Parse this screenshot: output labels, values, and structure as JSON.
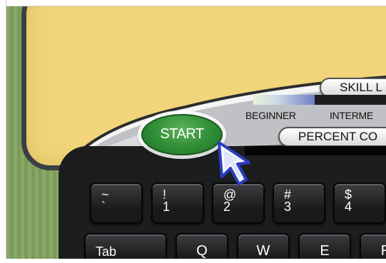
{
  "start_button": {
    "label": "START"
  },
  "skill_level": {
    "label": "SKILL L",
    "meter_fraction": 0.46,
    "levels": [
      "BEGINNER",
      "INTERME"
    ]
  },
  "percent_complete": {
    "label": "PERCENT CO"
  },
  "keys": {
    "tilde": {
      "top": "~",
      "bottom": "`"
    },
    "one": {
      "top": "!",
      "bottom": "1"
    },
    "two": {
      "top": "@",
      "bottom": "2"
    },
    "three": {
      "top": "#",
      "bottom": "3"
    },
    "four": {
      "top": "$",
      "bottom": "4"
    },
    "tab": "Tab",
    "q": "Q",
    "w": "W",
    "e": "E",
    "r": "R"
  },
  "colors": {
    "screen": "#f2d57a",
    "start_green": "#2e8d35",
    "background_green": "#89a866"
  },
  "icons": {
    "pointer": "hand-pointer-arrow"
  }
}
